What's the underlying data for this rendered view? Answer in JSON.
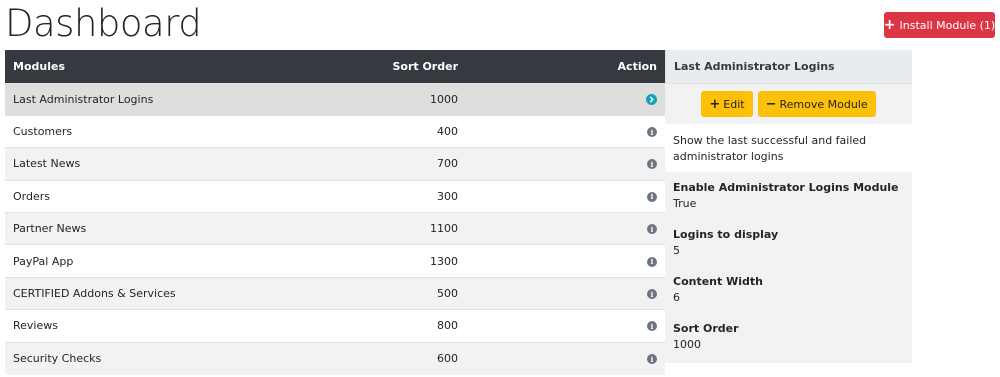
{
  "page": {
    "title": "Dashboard"
  },
  "header": {
    "install_button_label": "Install Module (1)"
  },
  "table": {
    "headers": {
      "modules": "Modules",
      "sort_order": "Sort Order",
      "action": "Action"
    },
    "rows": [
      {
        "name": "Last Administrator Logins",
        "sort_order": "1000",
        "selected": true
      },
      {
        "name": "Customers",
        "sort_order": "400"
      },
      {
        "name": "Latest News",
        "sort_order": "700"
      },
      {
        "name": "Orders",
        "sort_order": "300"
      },
      {
        "name": "Partner News",
        "sort_order": "1100"
      },
      {
        "name": "PayPal App",
        "sort_order": "1300"
      },
      {
        "name": "CERTIFIED Addons & Services",
        "sort_order": "500"
      },
      {
        "name": "Reviews",
        "sort_order": "800"
      },
      {
        "name": "Security Checks",
        "sort_order": "600"
      }
    ]
  },
  "panel": {
    "title": "Last Administrator Logins",
    "edit_label": "Edit",
    "remove_label": "Remove Module",
    "description": "Show the last successful and failed administrator logins",
    "config": [
      {
        "title": "Enable Administrator Logins Module",
        "value": "True"
      },
      {
        "title": "Logins to display",
        "value": "5"
      },
      {
        "title": "Content Width",
        "value": "6"
      },
      {
        "title": "Sort Order",
        "value": "1000"
      }
    ]
  },
  "colors": {
    "danger": "#dc3545",
    "warning": "#ffc107",
    "dark": "#343a40",
    "info": "#17a2b8"
  }
}
